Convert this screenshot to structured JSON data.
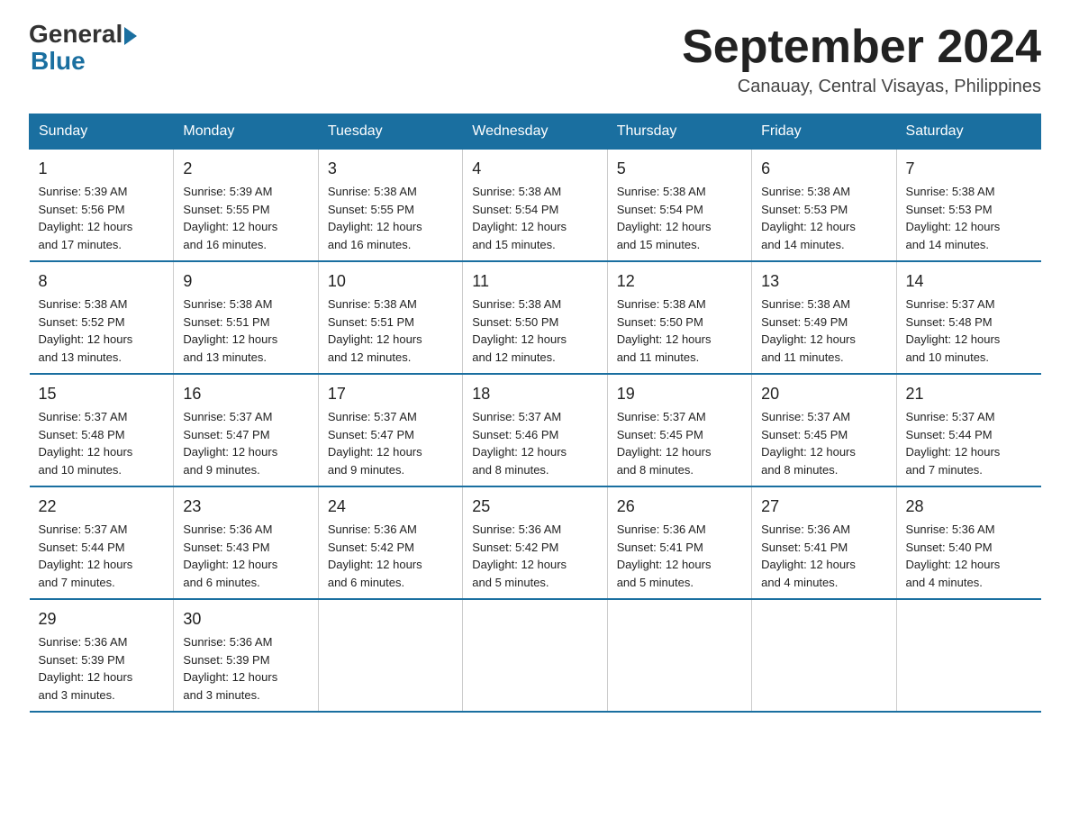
{
  "header": {
    "logo_general": "General",
    "logo_blue": "Blue",
    "month_title": "September 2024",
    "location": "Canauay, Central Visayas, Philippines"
  },
  "days_of_week": [
    "Sunday",
    "Monday",
    "Tuesday",
    "Wednesday",
    "Thursday",
    "Friday",
    "Saturday"
  ],
  "weeks": [
    [
      {
        "day": "1",
        "sunrise": "5:39 AM",
        "sunset": "5:56 PM",
        "daylight": "12 hours and 17 minutes."
      },
      {
        "day": "2",
        "sunrise": "5:39 AM",
        "sunset": "5:55 PM",
        "daylight": "12 hours and 16 minutes."
      },
      {
        "day": "3",
        "sunrise": "5:38 AM",
        "sunset": "5:55 PM",
        "daylight": "12 hours and 16 minutes."
      },
      {
        "day": "4",
        "sunrise": "5:38 AM",
        "sunset": "5:54 PM",
        "daylight": "12 hours and 15 minutes."
      },
      {
        "day": "5",
        "sunrise": "5:38 AM",
        "sunset": "5:54 PM",
        "daylight": "12 hours and 15 minutes."
      },
      {
        "day": "6",
        "sunrise": "5:38 AM",
        "sunset": "5:53 PM",
        "daylight": "12 hours and 14 minutes."
      },
      {
        "day": "7",
        "sunrise": "5:38 AM",
        "sunset": "5:53 PM",
        "daylight": "12 hours and 14 minutes."
      }
    ],
    [
      {
        "day": "8",
        "sunrise": "5:38 AM",
        "sunset": "5:52 PM",
        "daylight": "12 hours and 13 minutes."
      },
      {
        "day": "9",
        "sunrise": "5:38 AM",
        "sunset": "5:51 PM",
        "daylight": "12 hours and 13 minutes."
      },
      {
        "day": "10",
        "sunrise": "5:38 AM",
        "sunset": "5:51 PM",
        "daylight": "12 hours and 12 minutes."
      },
      {
        "day": "11",
        "sunrise": "5:38 AM",
        "sunset": "5:50 PM",
        "daylight": "12 hours and 12 minutes."
      },
      {
        "day": "12",
        "sunrise": "5:38 AM",
        "sunset": "5:50 PM",
        "daylight": "12 hours and 11 minutes."
      },
      {
        "day": "13",
        "sunrise": "5:38 AM",
        "sunset": "5:49 PM",
        "daylight": "12 hours and 11 minutes."
      },
      {
        "day": "14",
        "sunrise": "5:37 AM",
        "sunset": "5:48 PM",
        "daylight": "12 hours and 10 minutes."
      }
    ],
    [
      {
        "day": "15",
        "sunrise": "5:37 AM",
        "sunset": "5:48 PM",
        "daylight": "12 hours and 10 minutes."
      },
      {
        "day": "16",
        "sunrise": "5:37 AM",
        "sunset": "5:47 PM",
        "daylight": "12 hours and 9 minutes."
      },
      {
        "day": "17",
        "sunrise": "5:37 AM",
        "sunset": "5:47 PM",
        "daylight": "12 hours and 9 minutes."
      },
      {
        "day": "18",
        "sunrise": "5:37 AM",
        "sunset": "5:46 PM",
        "daylight": "12 hours and 8 minutes."
      },
      {
        "day": "19",
        "sunrise": "5:37 AM",
        "sunset": "5:45 PM",
        "daylight": "12 hours and 8 minutes."
      },
      {
        "day": "20",
        "sunrise": "5:37 AM",
        "sunset": "5:45 PM",
        "daylight": "12 hours and 8 minutes."
      },
      {
        "day": "21",
        "sunrise": "5:37 AM",
        "sunset": "5:44 PM",
        "daylight": "12 hours and 7 minutes."
      }
    ],
    [
      {
        "day": "22",
        "sunrise": "5:37 AM",
        "sunset": "5:44 PM",
        "daylight": "12 hours and 7 minutes."
      },
      {
        "day": "23",
        "sunrise": "5:36 AM",
        "sunset": "5:43 PM",
        "daylight": "12 hours and 6 minutes."
      },
      {
        "day": "24",
        "sunrise": "5:36 AM",
        "sunset": "5:42 PM",
        "daylight": "12 hours and 6 minutes."
      },
      {
        "day": "25",
        "sunrise": "5:36 AM",
        "sunset": "5:42 PM",
        "daylight": "12 hours and 5 minutes."
      },
      {
        "day": "26",
        "sunrise": "5:36 AM",
        "sunset": "5:41 PM",
        "daylight": "12 hours and 5 minutes."
      },
      {
        "day": "27",
        "sunrise": "5:36 AM",
        "sunset": "5:41 PM",
        "daylight": "12 hours and 4 minutes."
      },
      {
        "day": "28",
        "sunrise": "5:36 AM",
        "sunset": "5:40 PM",
        "daylight": "12 hours and 4 minutes."
      }
    ],
    [
      {
        "day": "29",
        "sunrise": "5:36 AM",
        "sunset": "5:39 PM",
        "daylight": "12 hours and 3 minutes."
      },
      {
        "day": "30",
        "sunrise": "5:36 AM",
        "sunset": "5:39 PM",
        "daylight": "12 hours and 3 minutes."
      },
      null,
      null,
      null,
      null,
      null
    ]
  ],
  "labels": {
    "sunrise": "Sunrise:",
    "sunset": "Sunset:",
    "daylight": "Daylight:"
  }
}
